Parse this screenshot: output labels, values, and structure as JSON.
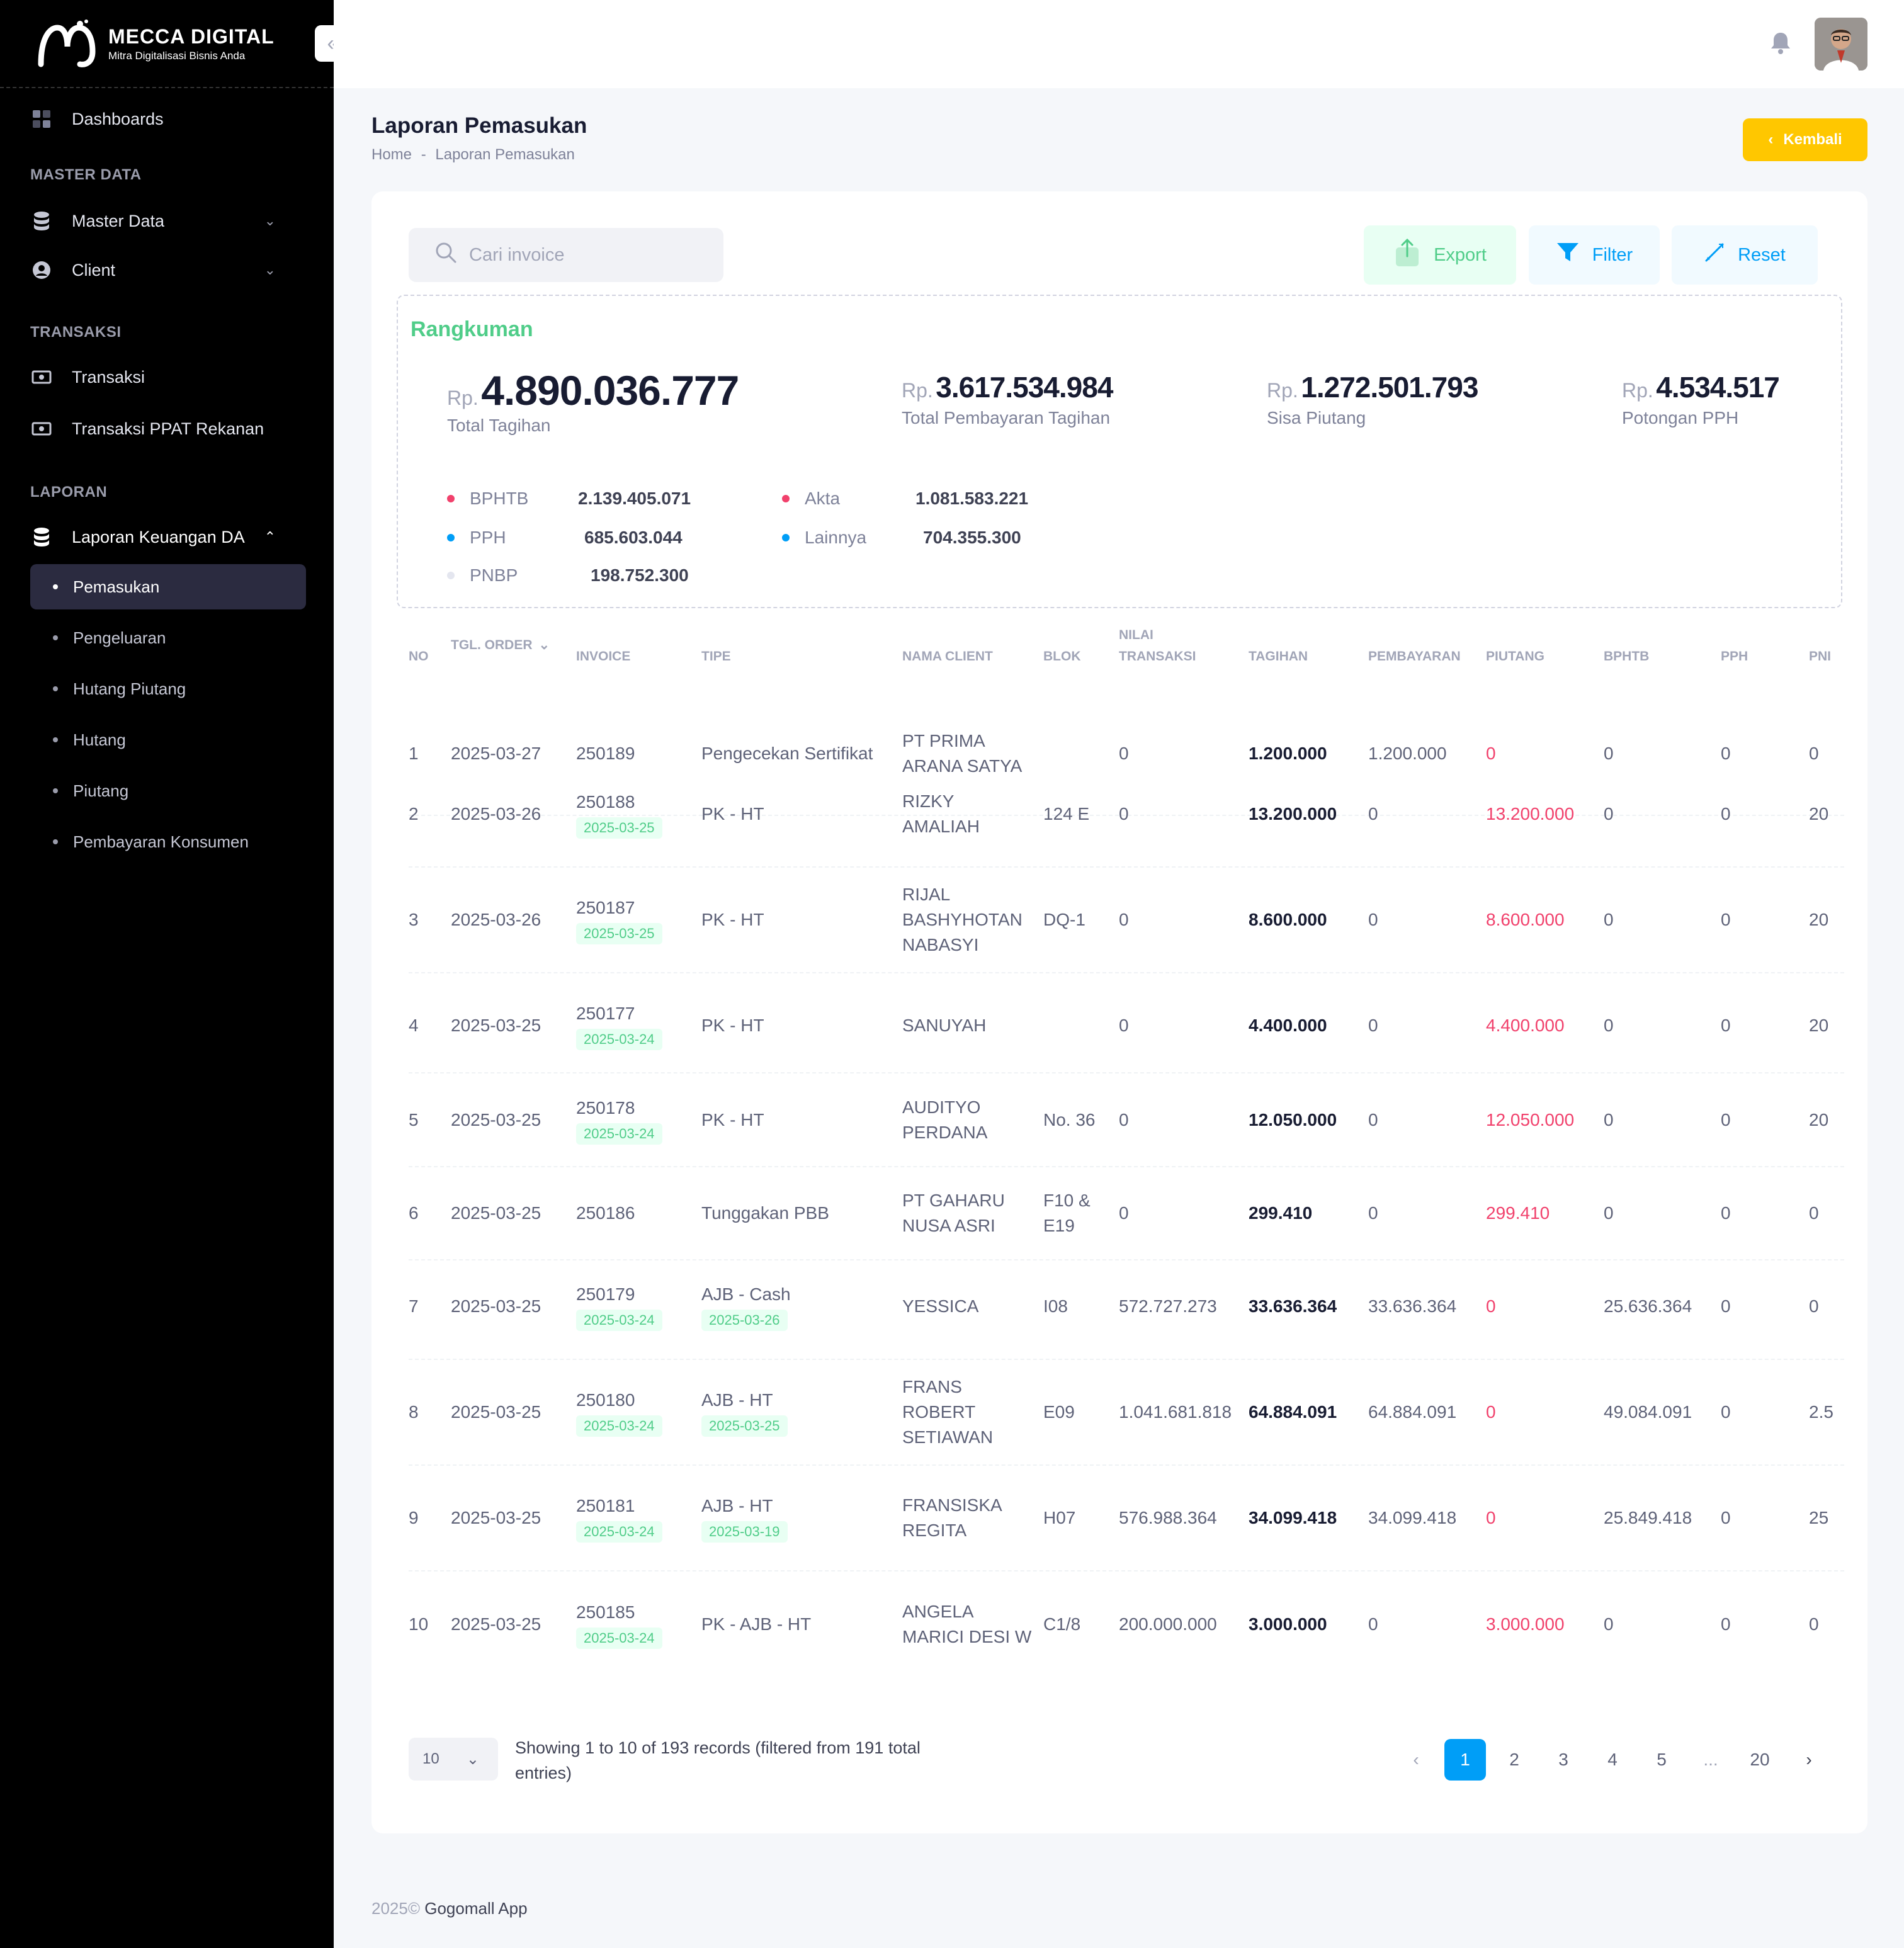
{
  "brand": {
    "title": "MECCA DIGITAL",
    "subtitle": "Mitra Digitalisasi Bisnis Anda"
  },
  "sidebar": {
    "dashboards": "Dashboards",
    "section_master": "MASTER DATA",
    "master_data": "Master Data",
    "client": "Client",
    "section_transaksi": "TRANSAKSI",
    "transaksi": "Transaksi",
    "transaksi_ppat": "Transaksi PPAT Rekanan",
    "section_laporan": "LAPORAN",
    "laporan_keuangan": "Laporan Keuangan DA",
    "sub_items": [
      "Pemasukan",
      "Pengeluaran",
      "Hutang Piutang",
      "Hutang",
      "Piutang",
      "Pembayaran Konsumen"
    ]
  },
  "page": {
    "title": "Laporan Pemasukan",
    "breadcrumb_home": "Home",
    "breadcrumb_sep": "-",
    "breadcrumb_current": "Laporan Pemasukan",
    "back_label": "Kembali"
  },
  "toolbar": {
    "search_placeholder": "Cari invoice",
    "export_label": "Export",
    "filter_label": "Filter",
    "reset_label": "Reset"
  },
  "summary": {
    "title": "Rangkuman",
    "rp": "Rp.",
    "total_tagihan": "4.890.036.777",
    "total_tagihan_label": "Total Tagihan",
    "total_pembayaran": "3.617.534.984",
    "total_pembayaran_label": "Total Pembayaran Tagihan",
    "sisa_piutang": "1.272.501.793",
    "sisa_piutang_label": "Sisa Piutang",
    "potongan_pph": "4.534.517",
    "potongan_pph_label": "Potongan PPH",
    "breakdown": [
      {
        "label": "BPHTB",
        "value": "2.139.405.071",
        "color": "#f1416c"
      },
      {
        "label": "PPH",
        "value": "685.603.044",
        "color": "#009ef7"
      },
      {
        "label": "PNBP",
        "value": "198.752.300",
        "color": "#e4e6ef"
      },
      {
        "label": "Akta",
        "value": "1.081.583.221",
        "color": "#f1416c"
      },
      {
        "label": "Lainnya",
        "value": "704.355.300",
        "color": "#009ef7"
      }
    ]
  },
  "table": {
    "headers": {
      "no": "NO",
      "tgl": "TGL. ORDER",
      "invoice": "INVOICE",
      "tipe": "TIPE",
      "client": "NAMA CLIENT",
      "blok": "BLOK",
      "nilai1": "NILAI",
      "nilai2": "TRANSAKSI",
      "tagihan": "TAGIHAN",
      "pembayaran": "PEMBAYARAN",
      "piutang": "PIUTANG",
      "bphtb": "BPHTB",
      "pph": "PPH",
      "pnbp": "PNI"
    },
    "rows": [
      {
        "no": "1",
        "tgl": "2025-03-27",
        "invoice": "250189",
        "inv_date": "",
        "tipe": "Pengecekan Sertifikat",
        "tipe_date": "",
        "client": "PT PRIMA ARANA SATYA",
        "blok": "",
        "nilai": "0",
        "tagihan": "1.200.000",
        "pembayaran": "1.200.000",
        "piutang": "0",
        "bphtb": "0",
        "pph": "0",
        "pnbp": "0"
      },
      {
        "no": "2",
        "tgl": "2025-03-26",
        "invoice": "250188",
        "inv_date": "2025-03-25",
        "tipe": "PK - HT",
        "tipe_date": "",
        "client": "RIZKY AMALIAH",
        "blok": "124 E",
        "nilai": "0",
        "tagihan": "13.200.000",
        "pembayaran": "0",
        "piutang": "13.200.000",
        "bphtb": "0",
        "pph": "0",
        "pnbp": "20"
      },
      {
        "no": "3",
        "tgl": "2025-03-26",
        "invoice": "250187",
        "inv_date": "2025-03-25",
        "tipe": "PK - HT",
        "tipe_date": "",
        "client": "RIJAL BASHYHOTAN NABASYI",
        "blok": "DQ-1",
        "nilai": "0",
        "tagihan": "8.600.000",
        "pembayaran": "0",
        "piutang": "8.600.000",
        "bphtb": "0",
        "pph": "0",
        "pnbp": "20"
      },
      {
        "no": "4",
        "tgl": "2025-03-25",
        "invoice": "250177",
        "inv_date": "2025-03-24",
        "tipe": "PK - HT",
        "tipe_date": "",
        "client": "SANUYAH",
        "blok": "",
        "nilai": "0",
        "tagihan": "4.400.000",
        "pembayaran": "0",
        "piutang": "4.400.000",
        "bphtb": "0",
        "pph": "0",
        "pnbp": "20"
      },
      {
        "no": "5",
        "tgl": "2025-03-25",
        "invoice": "250178",
        "inv_date": "2025-03-24",
        "tipe": "PK - HT",
        "tipe_date": "",
        "client": "AUDITYO PERDANA",
        "blok": "No. 36",
        "nilai": "0",
        "tagihan": "12.050.000",
        "pembayaran": "0",
        "piutang": "12.050.000",
        "bphtb": "0",
        "pph": "0",
        "pnbp": "20"
      },
      {
        "no": "6",
        "tgl": "2025-03-25",
        "invoice": "250186",
        "inv_date": "",
        "tipe": "Tunggakan PBB",
        "tipe_date": "",
        "client": "PT GAHARU NUSA ASRI",
        "blok": "F10 & E19",
        "nilai": "0",
        "tagihan": "299.410",
        "pembayaran": "0",
        "piutang": "299.410",
        "bphtb": "0",
        "pph": "0",
        "pnbp": "0"
      },
      {
        "no": "7",
        "tgl": "2025-03-25",
        "invoice": "250179",
        "inv_date": "2025-03-24",
        "tipe": "AJB - Cash",
        "tipe_date": "2025-03-26",
        "client": "YESSICA",
        "blok": "I08",
        "nilai": "572.727.273",
        "tagihan": "33.636.364",
        "pembayaran": "33.636.364",
        "piutang": "0",
        "bphtb": "25.636.364",
        "pph": "0",
        "pnbp": "0"
      },
      {
        "no": "8",
        "tgl": "2025-03-25",
        "invoice": "250180",
        "inv_date": "2025-03-24",
        "tipe": "AJB - HT",
        "tipe_date": "2025-03-25",
        "client": "FRANS ROBERT SETIAWAN",
        "blok": "E09",
        "nilai": "1.041.681.818",
        "tagihan": "64.884.091",
        "pembayaran": "64.884.091",
        "piutang": "0",
        "bphtb": "49.084.091",
        "pph": "0",
        "pnbp": "2.5"
      },
      {
        "no": "9",
        "tgl": "2025-03-25",
        "invoice": "250181",
        "inv_date": "2025-03-24",
        "tipe": "AJB - HT",
        "tipe_date": "2025-03-19",
        "client": "FRANSISKA REGITA",
        "blok": "H07",
        "nilai": "576.988.364",
        "tagihan": "34.099.418",
        "pembayaran": "34.099.418",
        "piutang": "0",
        "bphtb": "25.849.418",
        "pph": "0",
        "pnbp": "25"
      },
      {
        "no": "10",
        "tgl": "2025-03-25",
        "invoice": "250185",
        "inv_date": "2025-03-24",
        "tipe": "PK - AJB - HT",
        "tipe_date": "",
        "client": "ANGELA MARICI DESI W",
        "blok": "C1/8",
        "nilai": "200.000.000",
        "tagihan": "3.000.000",
        "pembayaran": "0",
        "piutang": "3.000.000",
        "bphtb": "0",
        "pph": "0",
        "pnbp": "0"
      }
    ]
  },
  "pagination": {
    "page_size": "10",
    "showing": "Showing 1 to 10 of 193 records (filtered from 191 total entries)",
    "pages": [
      "1",
      "2",
      "3",
      "4",
      "5",
      "...",
      "20"
    ],
    "active_page": "1"
  },
  "footer": {
    "year": "2025©",
    "app": "Gogomall App"
  },
  "colors": {
    "accent": "#009ef7",
    "success": "#50cd89",
    "danger": "#f1416c",
    "warning": "#ffc700"
  }
}
